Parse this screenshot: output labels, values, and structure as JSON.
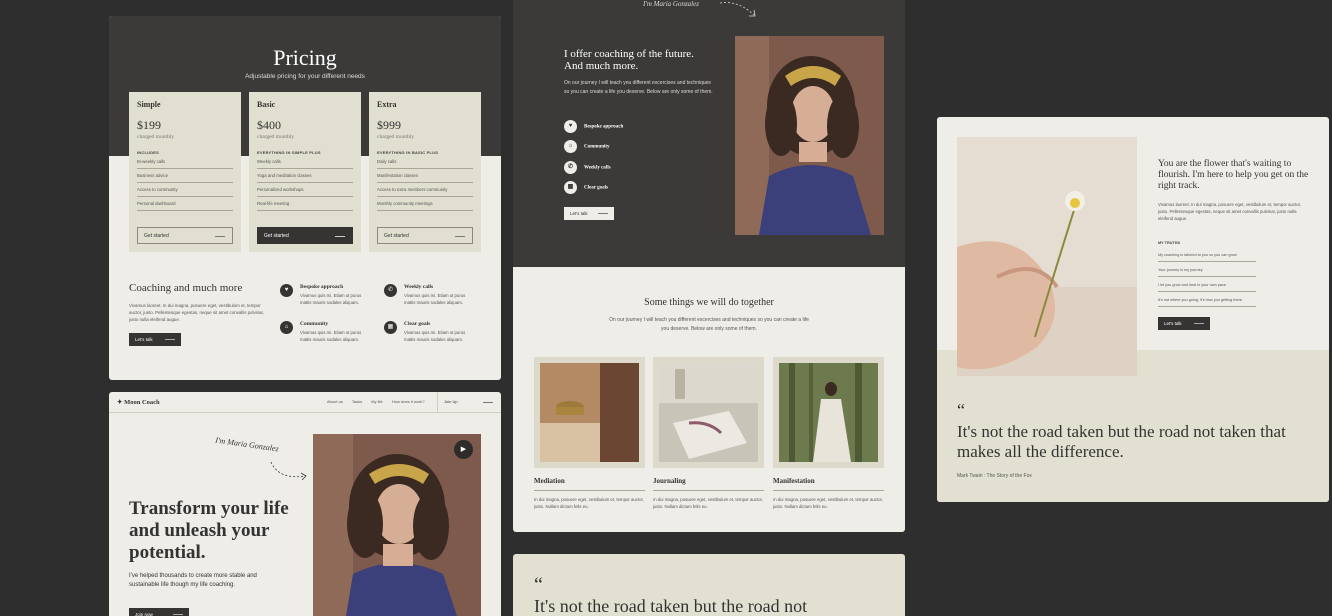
{
  "pricing": {
    "title": "Pricing",
    "subtitle": "Adjustable pricing for your different needs",
    "plans": [
      {
        "name": "Simple",
        "price": "$199",
        "period": "charged monthly",
        "includes": "INCLUDES",
        "features": [
          "Bi-weekly calls",
          "Business advice",
          "Access to community",
          "Personal dashboard"
        ],
        "cta": "Get started"
      },
      {
        "name": "Basic",
        "price": "$400",
        "period": "charged monthly",
        "includes": "EVERYTHING IN SIMPLE PLUS",
        "features": [
          "Weekly calls",
          "Yoga and meditation classes",
          "Personalized workshops",
          "Real-life meeting"
        ],
        "cta": "Get started"
      },
      {
        "name": "Extra",
        "price": "$999",
        "period": "charged monthly",
        "includes": "EVERYTHING IN BASIC PLUS",
        "features": [
          "Daily calls",
          "Manifestation classes",
          "Access to extra members community",
          "Monthly community meetings"
        ],
        "cta": "Get started"
      }
    ],
    "coaching_title": "Coaching and much more",
    "coaching_text": "Vivamus laoreet. In dui magna, posuere eget, vestibulum et, tempor auctor, justo. Pellentesque egestas, neque sit amet convallis pulvinar, justo nulla eleifend augue.",
    "cta": "Let's talk",
    "features": [
      {
        "title": "Bespoke approach",
        "desc": "Vivamus quis mi. Etiam ut purus mattis mauris sodales aliquam."
      },
      {
        "title": "Weekly calls",
        "desc": "Vivamus quis mi. Etiam ut purus mattis mauris sodales aliquam."
      },
      {
        "title": "Community",
        "desc": "Vivamus quis mi. Etiam ut purus mattis mauris sodales aliquam."
      },
      {
        "title": "Clear goals",
        "desc": "Vivamus quis mi. Etiam ut purus mattis mauris sodales aliquam."
      }
    ]
  },
  "hero": {
    "logo": "Moon Coach",
    "nav": [
      "About us",
      "Tasks",
      "My life",
      "How does it work?"
    ],
    "join": "Join Up",
    "signature": "I'm Maria Gonzalez",
    "headline": "Transform your life and unleash your potential.",
    "lead": "I've helped thousands to create more stable and sustainable life though my life coaching.",
    "cta": "Join now"
  },
  "coaching": {
    "signature": "I'm Maria Gonzalez",
    "title": "I offer coaching of the future. And much more.",
    "text": "On our journey I will teach you different excercises and techniques so you can create a life you deserve. Below are only some of them.",
    "list": [
      "Bespoke approach",
      "Community",
      "Weekly calls",
      "Clear goals"
    ],
    "cta": "Let's talk",
    "section_title": "Some things we will do together",
    "section_text": "On our journey I will teach you different excercises and techniques so you can create a life you deserve. Below are only some of them.",
    "activities": [
      {
        "name": "Mediation",
        "desc": "In dui magna, posuere eget, vestibulum et, tempor auctor, justo. Nullam dictum felis eu."
      },
      {
        "name": "Journaling",
        "desc": "In dui magna, posuere eget, vestibulum et, tempor auctor, justo. Nullam dictum felis eu."
      },
      {
        "name": "Manifestation",
        "desc": "In dui magna, posuere eget, vestibulum et, tempor auctor, justo. Nullam dictum felis eu."
      }
    ]
  },
  "quote_bottom": {
    "mark": "“",
    "text": "It's not the road taken but the road not"
  },
  "flower": {
    "title": "You are the flower that's waiting to flourish. I'm here to help you get on the right track.",
    "text": "Vivamus laoreet. In dui magna, posuere eget, vestibulum et, tempor auctor, justo. Pellentesque egestas, neque sit amet convallis pulvinar, justo nulla eleifend augue.",
    "truths_label": "MY TRUTHS",
    "truths": [
      "My coaching is tailored to you so you can grow",
      "Your journey is my journey",
      "I let you grow and heal in your own pace",
      "It's not where you going, it's how you getting there"
    ],
    "cta": "Let's talk",
    "quote_mark": "“",
    "quote": "It's not the road taken but the road not taken that makes all the difference.",
    "author": "Mark Twain : The Story of the Fox"
  }
}
